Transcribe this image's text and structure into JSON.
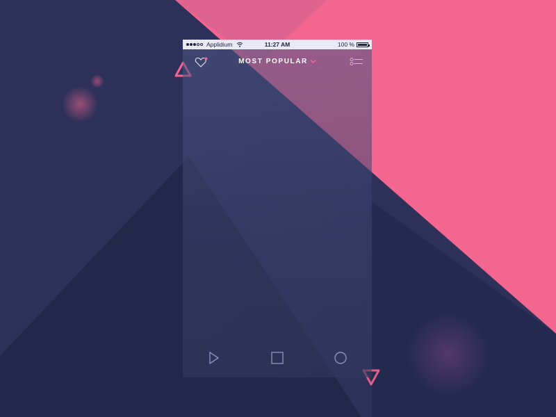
{
  "colors": {
    "navy_dark": "#242a4f",
    "navy_mid": "#2d3159",
    "pink": "#f26690",
    "phone_bg": "#3e4577",
    "white": "#ffffff",
    "status_bar_bg": "#e9eaf3"
  },
  "status_bar": {
    "carrier": "Applidium",
    "time": "11:27 AM",
    "battery": "100 %"
  },
  "nav": {
    "title": "MOST POPULAR",
    "left_icon": "heart-icon",
    "right_icon": "list-toggle-icon",
    "title_icon": "chevron-down-icon"
  },
  "tab_bar": {
    "items": [
      {
        "icon": "play-icon"
      },
      {
        "icon": "square-icon"
      },
      {
        "icon": "circle-icon"
      }
    ]
  }
}
